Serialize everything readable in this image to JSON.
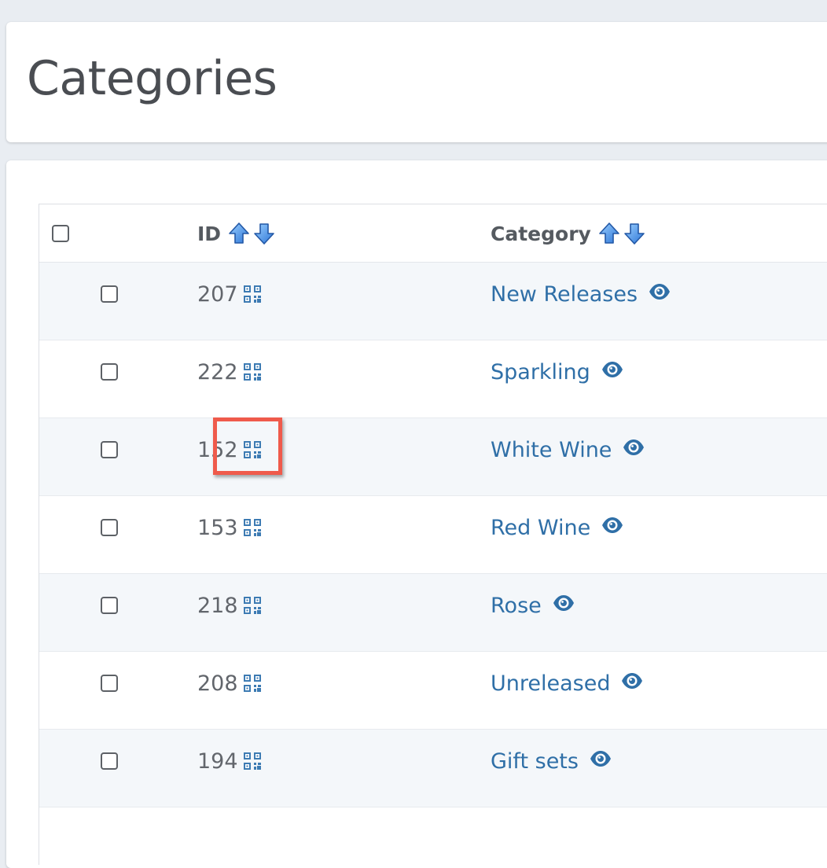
{
  "page": {
    "title": "Categories"
  },
  "table": {
    "columns": [
      {
        "label": "ID"
      },
      {
        "label": "Category"
      }
    ],
    "rows": [
      {
        "id": "207",
        "category": "New Releases"
      },
      {
        "id": "222",
        "category": "Sparkling"
      },
      {
        "id": "152",
        "category": "White Wine"
      },
      {
        "id": "153",
        "category": "Red Wine"
      },
      {
        "id": "218",
        "category": "Rose"
      },
      {
        "id": "208",
        "category": "Unreleased"
      },
      {
        "id": "194",
        "category": "Gift sets"
      }
    ]
  },
  "colors": {
    "background": "#e9edf2",
    "link": "#2f6fa7",
    "highlight": "#ef5a4b",
    "row_alt": "#f4f7fa"
  },
  "icons": {
    "sort_up": "arrow-up-icon",
    "sort_down": "arrow-down-icon",
    "id_action": "qr-code-icon",
    "category_action": "eye-icon"
  }
}
